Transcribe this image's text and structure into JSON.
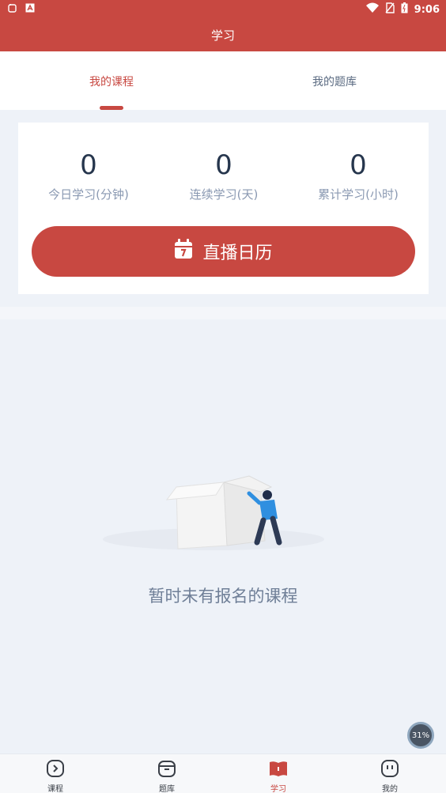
{
  "status_bar": {
    "time": "9:06"
  },
  "header": {
    "title": "学习"
  },
  "tabs": [
    {
      "label": "我的课程",
      "active": true
    },
    {
      "label": "我的题库",
      "active": false
    }
  ],
  "stats": [
    {
      "value": "0",
      "label": "今日学习(分钟)"
    },
    {
      "value": "0",
      "label": "连续学习(天)"
    },
    {
      "value": "0",
      "label": "累计学习(小时)"
    }
  ],
  "live_button": {
    "label": "直播日历",
    "icon": "calendar-icon"
  },
  "empty_state": {
    "message": "暂时未有报名的课程"
  },
  "progress_badge": {
    "value": "31%"
  },
  "bottom_nav": [
    {
      "label": "课程",
      "icon": "play-circle-icon",
      "active": false
    },
    {
      "label": "题库",
      "icon": "box-icon",
      "active": false
    },
    {
      "label": "学习",
      "icon": "book-icon",
      "active": true
    },
    {
      "label": "我的",
      "icon": "face-icon",
      "active": false
    }
  ],
  "colors": {
    "primary": "#c84841",
    "background": "#eef2f8",
    "text_dark": "#26364d",
    "text_muted": "#8a99b2"
  }
}
